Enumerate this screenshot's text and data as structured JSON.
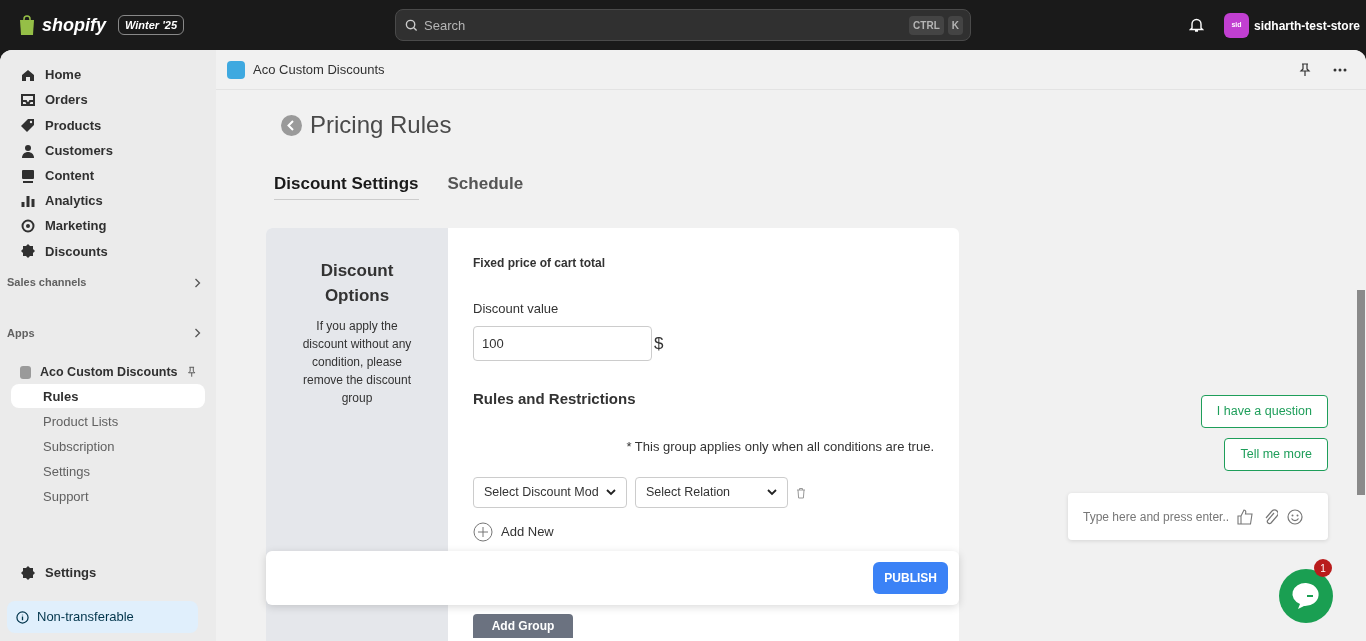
{
  "topbar": {
    "brand": "shopify",
    "edition": "Winter '25",
    "search": {
      "placeholder": "Search",
      "keys": [
        "CTRL",
        "K"
      ]
    },
    "store": {
      "avatar": "sid",
      "name": "sidharth-test-store"
    }
  },
  "sidebar": {
    "nav": [
      {
        "label": "Home",
        "selected": false
      },
      {
        "label": "Orders",
        "selected": false
      },
      {
        "label": "Products",
        "selected": false
      },
      {
        "label": "Customers",
        "selected": false
      },
      {
        "label": "Content",
        "selected": false
      },
      {
        "label": "Analytics",
        "selected": false
      },
      {
        "label": "Marketing",
        "selected": false
      },
      {
        "label": "Discounts",
        "selected": false
      }
    ],
    "sections": [
      "Sales channels",
      "Apps"
    ],
    "app": {
      "name": "Aco Custom Discounts",
      "items": [
        {
          "label": "Rules",
          "selected": true
        },
        {
          "label": "Product Lists",
          "selected": false
        },
        {
          "label": "Subscription",
          "selected": false
        },
        {
          "label": "Settings",
          "selected": false
        },
        {
          "label": "Support",
          "selected": false
        }
      ]
    },
    "settings": "Settings",
    "notice": "Non-transferable"
  },
  "app_header": {
    "title": "Aco Custom Discounts"
  },
  "page": {
    "title": "Pricing Rules",
    "tabs": [
      {
        "label": "Discount Settings",
        "selected": true
      },
      {
        "label": "Schedule",
        "selected": false
      }
    ],
    "options": {
      "title": "Discount Options",
      "text": "If you apply the discount without any condition, please remove the discount group"
    },
    "type": "Fixed price of cart total",
    "discount_value": {
      "label": "Discount value",
      "value": "100",
      "unit": "$"
    },
    "rules_title": "Rules and Restrictions",
    "note": "* This group applies only when all conditions are true.",
    "selects": [
      "Select Discount Mod",
      "Select Relation"
    ],
    "add_new": "Add New",
    "publish": "PUBLISH",
    "add_group": "Add Group"
  },
  "chat": {
    "replies": [
      "I have a question",
      "Tell me more"
    ],
    "input_placeholder": "Type here and press enter..",
    "badge": "1"
  }
}
